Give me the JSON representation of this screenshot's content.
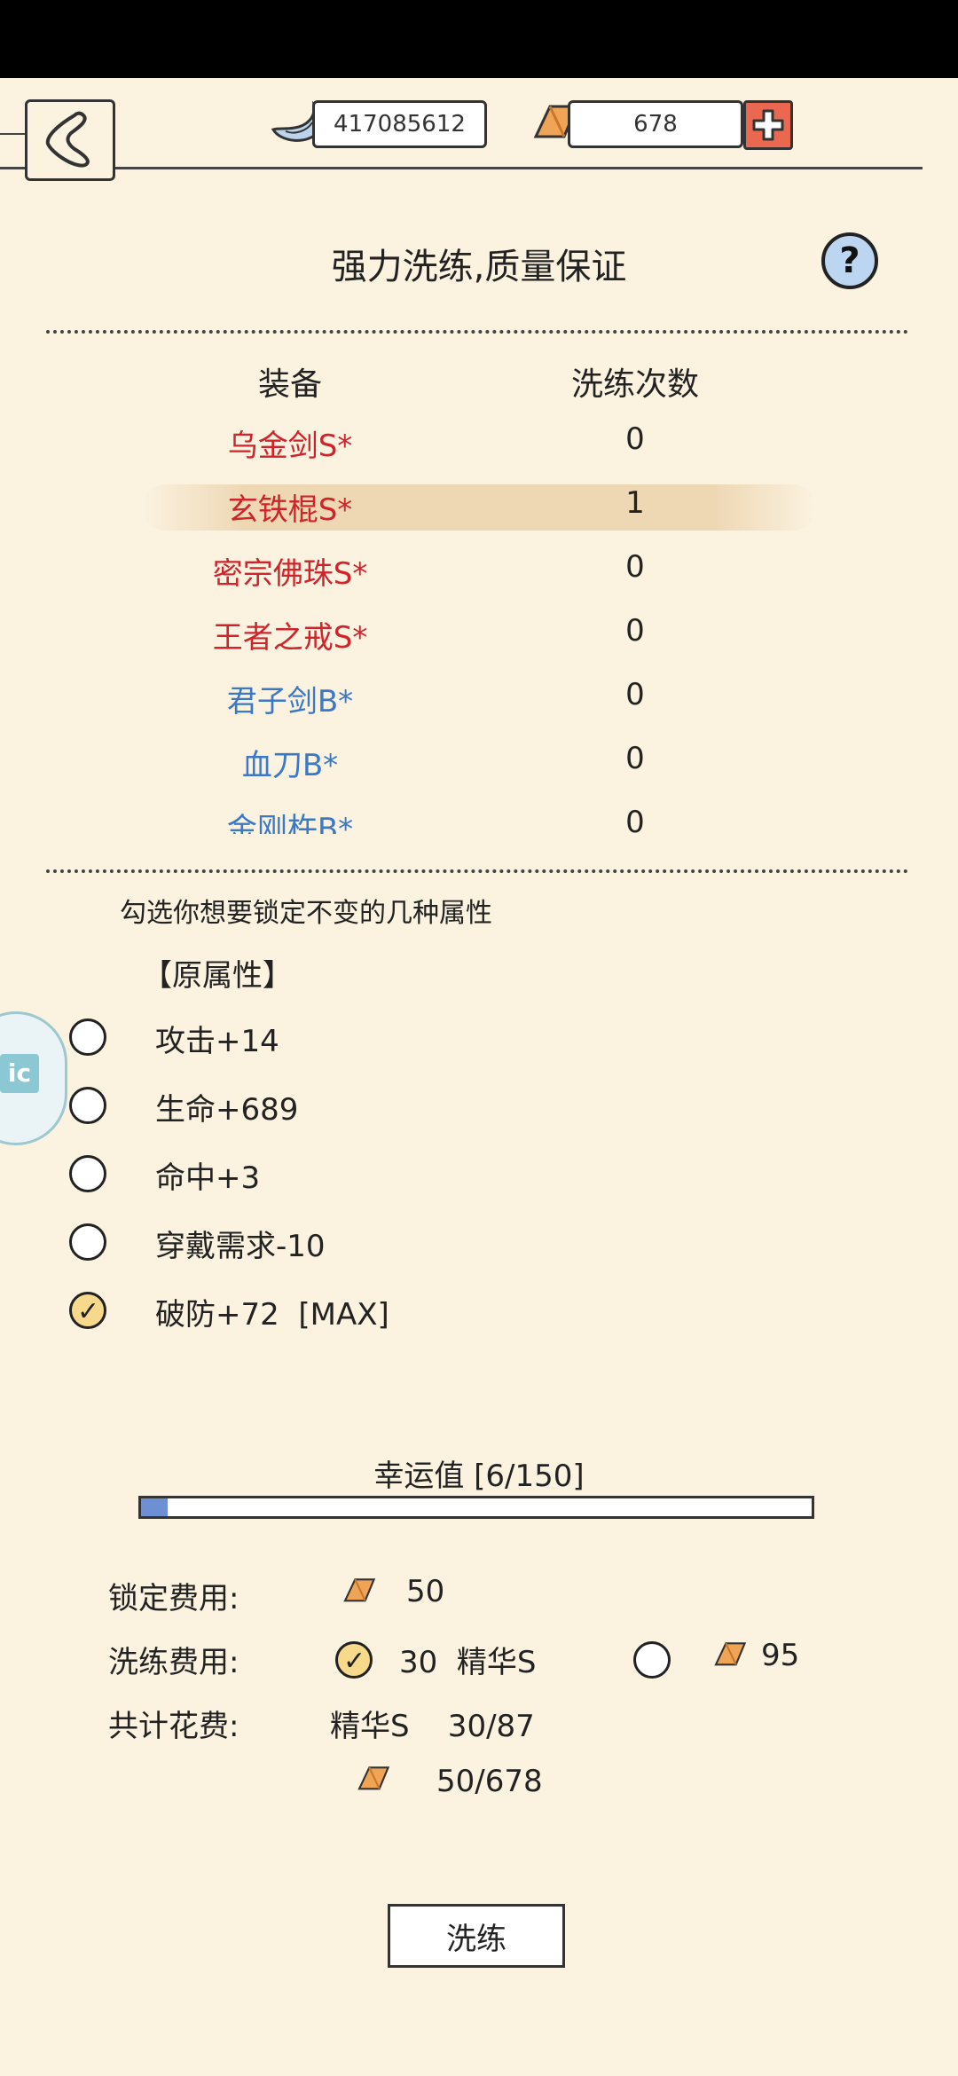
{
  "topbar": {
    "silver_amount": "417085612",
    "gold_amount": "678"
  },
  "title": "强力洗练,质量保证",
  "help_label": "?",
  "table": {
    "col_equipment": "装备",
    "col_count": "洗练次数",
    "rows": [
      {
        "name": "乌金剑S*",
        "count": "0",
        "color": "#d0232a"
      },
      {
        "name": "玄铁棍S*",
        "count": "1",
        "color": "#d0232a",
        "selected": true
      },
      {
        "name": "密宗佛珠S*",
        "count": "0",
        "color": "#d0232a"
      },
      {
        "name": "王者之戒S*",
        "count": "0",
        "color": "#d0232a"
      },
      {
        "name": "君子剑B*",
        "count": "0",
        "color": "#3a78c8"
      },
      {
        "name": "血刀B*",
        "count": "0",
        "color": "#3a78c8"
      },
      {
        "name": "金刚杵B*",
        "count": "0",
        "color": "#3a78c8"
      }
    ]
  },
  "lock": {
    "hint": "勾选你想要锁定不变的几种属性",
    "group_label": "【原属性】",
    "attributes": [
      {
        "label": "攻击+14",
        "checked": false
      },
      {
        "label": "生命+689",
        "checked": false
      },
      {
        "label": "命中+3",
        "checked": false
      },
      {
        "label": "穿戴需求-10",
        "checked": false
      },
      {
        "label": "破防+72  [MAX]",
        "checked": true
      }
    ]
  },
  "luck": {
    "label": "幸运值 [6/150]",
    "current": 6,
    "max": 150
  },
  "costs": {
    "lock_label": "锁定费用:",
    "lock_value": "50",
    "wash_label": "洗练费用:",
    "wash_option1": "30  精华S",
    "wash_option1_checked": true,
    "wash_option2": "95",
    "wash_option2_checked": false,
    "total_label": "共计花费:",
    "total_essence": "精华S    30/87",
    "total_gold": "50/678"
  },
  "wash_button": "洗练",
  "side_float_icon": "ic",
  "colors": {
    "background": "#fbf2e0",
    "s_rank": "#d0232a",
    "b_rank": "#3a78c8",
    "plus_button": "#e9684f",
    "luck_fill": "#6d8fd4"
  }
}
